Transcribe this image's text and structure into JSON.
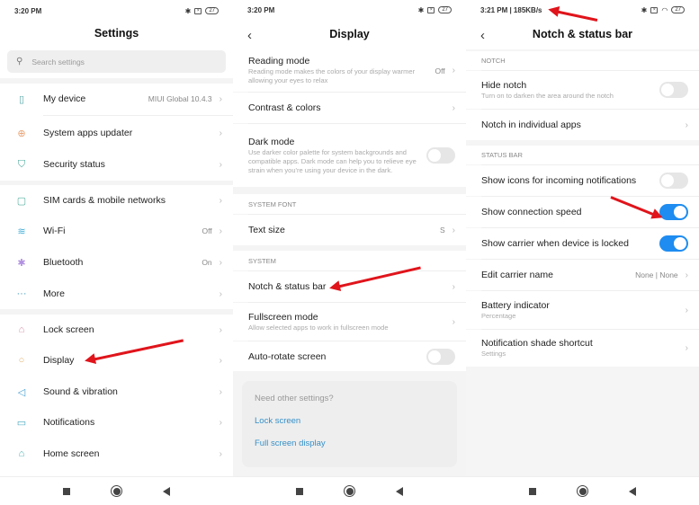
{
  "panels": {
    "settings": {
      "status_time": "3:20 PM",
      "battery": "27",
      "title": "Settings",
      "search_placeholder": "Search settings",
      "items": [
        {
          "label": "My device",
          "value": "MIUI Global 10.4.3",
          "icon": "phone-icon",
          "color": "#5aa8a8"
        },
        {
          "label": "System apps updater",
          "value": "",
          "icon": "update-icon",
          "color": "#e8a070"
        },
        {
          "label": "Security status",
          "value": "",
          "icon": "shield-icon",
          "color": "#4aa89a"
        },
        {
          "label": "SIM cards & mobile networks",
          "value": "",
          "icon": "sim-icon",
          "color": "#5ab0a0"
        },
        {
          "label": "Wi-Fi",
          "value": "Off",
          "icon": "wifi-icon",
          "color": "#4ab0d8"
        },
        {
          "label": "Bluetooth",
          "value": "On",
          "icon": "bluetooth-icon",
          "color": "#b090e0"
        },
        {
          "label": "More",
          "value": "",
          "icon": "more-icon",
          "color": "#4aa0c0"
        },
        {
          "label": "Lock screen",
          "value": "",
          "icon": "lock-icon",
          "color": "#d890a8"
        },
        {
          "label": "Display",
          "value": "",
          "icon": "display-icon",
          "color": "#e0b070"
        },
        {
          "label": "Sound & vibration",
          "value": "",
          "icon": "sound-icon",
          "color": "#4aa0d0"
        },
        {
          "label": "Notifications",
          "value": "",
          "icon": "notification-icon",
          "color": "#4aa8c0"
        },
        {
          "label": "Home screen",
          "value": "",
          "icon": "home-icon",
          "color": "#4ab0b0"
        }
      ]
    },
    "display": {
      "status_time": "3:20 PM",
      "battery": "27",
      "title": "Display",
      "reading_mode": {
        "title": "Reading mode",
        "sub": "Reading mode makes the colors of your display warmer allowing your eyes to relax",
        "value": "Off"
      },
      "contrast": {
        "title": "Contrast & colors"
      },
      "dark_mode": {
        "title": "Dark mode",
        "sub": "Use darker color palette for system backgrounds and compatible apps. Dark mode can help you to relieve eye strain when you're using your device in the dark.",
        "on": false
      },
      "section_font": "SYSTEM FONT",
      "text_size": {
        "title": "Text size",
        "value": "S"
      },
      "section_system": "SYSTEM",
      "notch": {
        "title": "Notch & status bar"
      },
      "fullscreen": {
        "title": "Fullscreen mode",
        "sub": "Allow selected apps to work in fullscreen mode"
      },
      "autorotate": {
        "title": "Auto-rotate screen",
        "on": false
      },
      "card": {
        "question": "Need other settings?",
        "link1": "Lock screen",
        "link2": "Full screen display"
      }
    },
    "notch": {
      "status_time": "3:21 PM | 185KB/s",
      "battery": "27",
      "title": "Notch & status bar",
      "section_notch": "NOTCH",
      "hide_notch": {
        "title": "Hide notch",
        "sub": "Turn on to darken the area around the notch",
        "on": false
      },
      "notch_apps": {
        "title": "Notch in individual apps"
      },
      "section_status": "STATUS BAR",
      "show_icons": {
        "title": "Show icons for incoming notifications",
        "on": false
      },
      "show_speed": {
        "title": "Show connection speed",
        "on": true
      },
      "show_carrier": {
        "title": "Show carrier when device is locked",
        "on": true
      },
      "edit_carrier": {
        "title": "Edit carrier name",
        "value": "None | None"
      },
      "battery_ind": {
        "title": "Battery indicator",
        "sub": "Percentage"
      },
      "shade": {
        "title": "Notification shade shortcut",
        "sub": "Settings"
      }
    }
  },
  "colors": {
    "accent": "#1e8cf0",
    "arrow": "#e0141b",
    "link": "#3590c8"
  },
  "icons": {
    "chevron": "›",
    "back": "‹",
    "search": "⌕"
  }
}
